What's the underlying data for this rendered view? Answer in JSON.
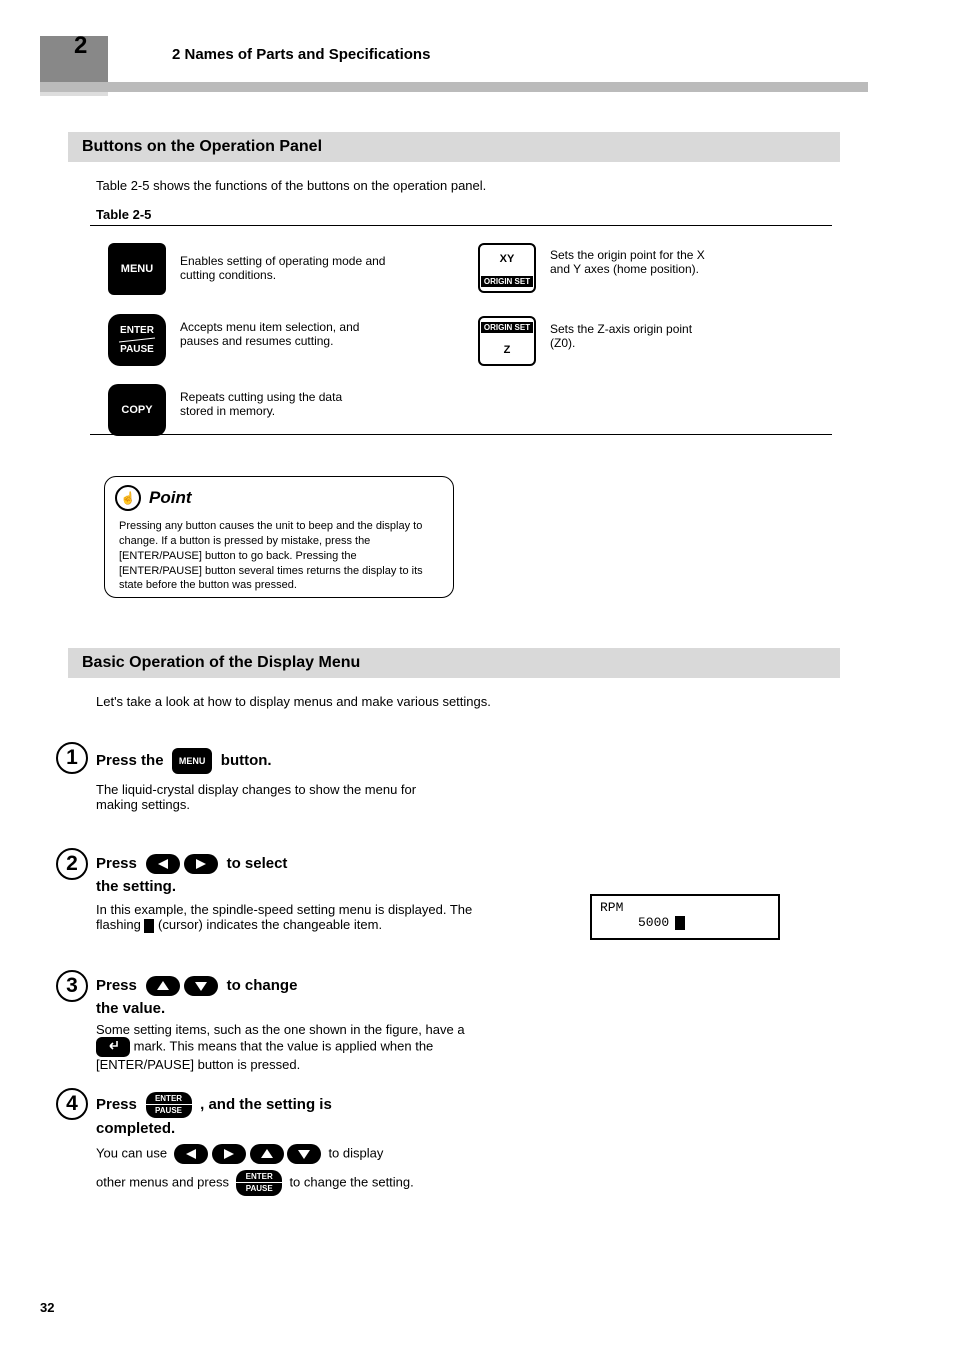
{
  "page": {
    "number": "2",
    "title": "2    Names of Parts and Specifications"
  },
  "section1": {
    "title": "Buttons on the Operation Panel",
    "intro": "Table 2-5 shows the functions of the buttons on the operation panel.",
    "table_label": "Table 2-5"
  },
  "buttons": {
    "menu": {
      "label": "MENU",
      "desc": "Enables setting of operating mode and cutting conditions."
    },
    "enter": {
      "label_top": "ENTER",
      "label_bottom": "PAUSE",
      "desc": "Accepts menu item selection, and\npauses and resumes cutting."
    },
    "copy": {
      "label": "COPY",
      "desc": "Repeats cutting using the data\nstored in memory."
    },
    "xy": {
      "label_top": "XY",
      "label_bottom": "ORIGIN SET",
      "desc": "Sets the origin point for the X\nand Y axes (home position)."
    },
    "z": {
      "label_top": "ORIGIN SET",
      "label_bottom": "Z",
      "desc": "Sets the Z-axis origin point\n(Z0)."
    }
  },
  "point": {
    "icon": "☝",
    "title": "Point",
    "body": "Pressing any button causes the unit to beep and the display to change. If a button is pressed by mistake, press the [ENTER/PAUSE] button to go back. Pressing the [ENTER/PAUSE] button several times returns the display to its state before the button was pressed."
  },
  "section2": {
    "title": "Basic Operation of the Display Menu",
    "intro": "Let's take a look at how to display menus and make various settings.",
    "steps": {
      "s1": {
        "num": "1",
        "text": "Press the              button.",
        "sub": "The liquid-crystal display changes to show the menu for making settings."
      },
      "s2": {
        "num": "2",
        "text": "Press                              to select\nthe setting.",
        "sub": "In this example, the spindle-speed setting menu is displayed.\nThe flashing ",
        "cursor": "█",
        "sub_tail": "  (cursor) indicates the changeable item."
      },
      "s3": {
        "num": "3",
        "text": "Press                              to change\nthe value.",
        "sub": "Some setting items, such as the one shown in the figure, have a  ",
        "arrow_label": "↵",
        "sub2": "  mark. This means that the value is applied when the [ENTER/PAUSE] button is pressed."
      },
      "s4": {
        "num": "4",
        "text": "Press               , and the setting is\ncompleted.",
        "sub": "You can use                                                to display\nother menus and press                to change the setting."
      }
    }
  },
  "lcd": {
    "line1": "  RPM",
    "line2": "5000"
  },
  "footer": "32"
}
